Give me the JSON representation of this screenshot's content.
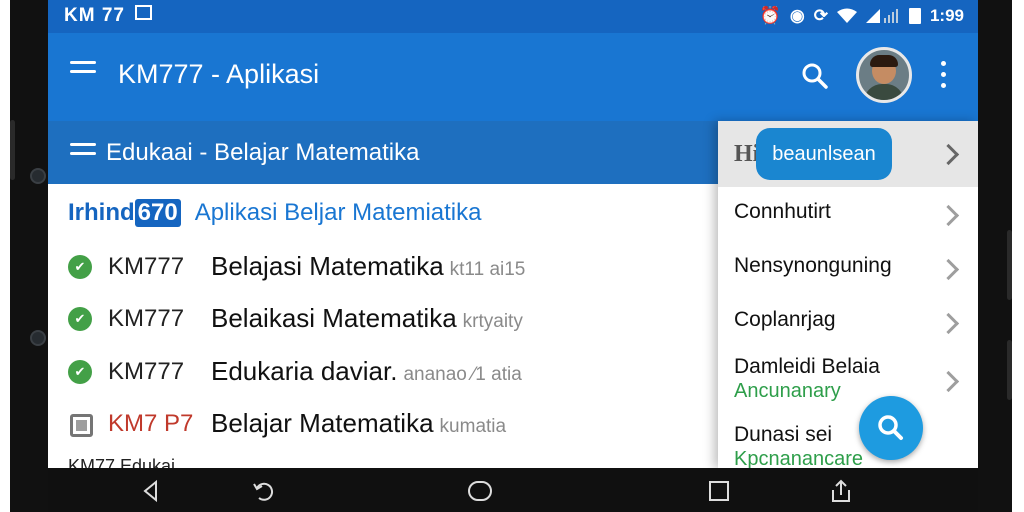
{
  "status_bar": {
    "left_text": "KM 77",
    "time": "1:99",
    "icons": [
      "alarm-icon",
      "circle-icon",
      "sync-icon",
      "wifi-icon",
      "signal-icon",
      "battery-icon"
    ]
  },
  "app_bar": {
    "title": "KM777 - Aplikasi",
    "icons": [
      "menu-icon",
      "search-icon",
      "avatar",
      "more-vert-icon"
    ]
  },
  "section_header": {
    "title": "Edukaai  - Belajar Matematika"
  },
  "list": {
    "heading_prefix": "Irhind",
    "heading_num": "670",
    "heading_text": "Aplikasi Beljar Matemiatika",
    "rows": [
      {
        "code": "KM777",
        "text": "Belajasi Matematika",
        "sub": "kt11 ai15",
        "icon": "shield-check-icon"
      },
      {
        "code": "KM777",
        "text": "Belaikasi Matematika",
        "sub": "krtyaity",
        "icon": "check-circle-icon"
      },
      {
        "code": "KM777",
        "text": "Edukaria daviar.",
        "sub": "ananao ⁄1 atia",
        "icon": "check-circle-icon"
      },
      {
        "code": "KM7 P7",
        "text": "Belajar Matematika",
        "sub": "kumatia",
        "icon": "stop-square-icon"
      }
    ],
    "partial_row": "KM77 Edukai"
  },
  "drawer": {
    "head_label": "Hi",
    "pill_label": "beaunlsean",
    "items": [
      {
        "label": "Connhutirt",
        "sub": ""
      },
      {
        "label": "Nensynonguning",
        "sub": ""
      },
      {
        "label": "Coplanrjag",
        "sub": ""
      },
      {
        "label": "Damleidi Belaia",
        "sub": "Ancunanary"
      },
      {
        "label": "Dunasi sei",
        "sub": "Kpcnanancare"
      }
    ]
  },
  "fab": {
    "icon": "search-icon"
  },
  "nav_bar": {
    "icons": [
      "back-icon",
      "rotate-icon",
      "home-icon",
      "recents-icon",
      "share-icon"
    ]
  },
  "colors": {
    "status_bar": "#1565c0",
    "app_bar": "#1976d2",
    "section_header": "#1e6fbf",
    "accent_green": "#43a047",
    "fab": "#1e9be0"
  }
}
